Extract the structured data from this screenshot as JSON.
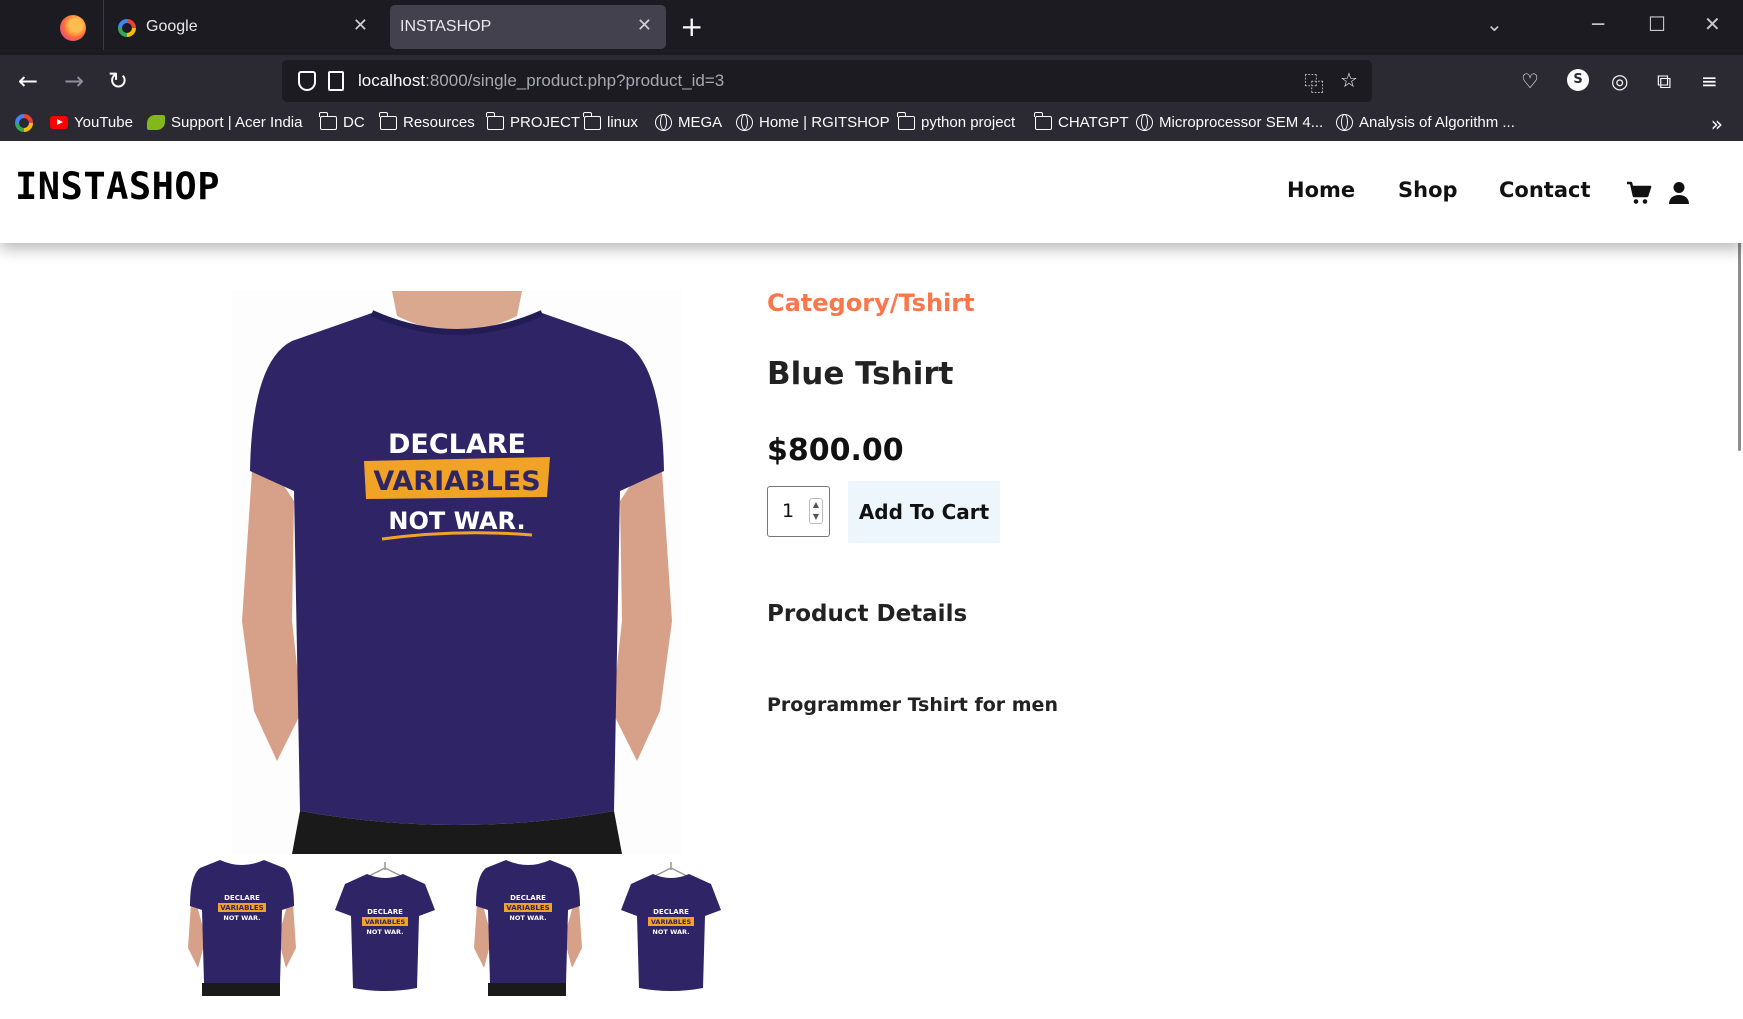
{
  "browser": {
    "tabs": [
      {
        "title": "Google",
        "active": false
      },
      {
        "title": "INSTASHOP",
        "active": true
      }
    ],
    "url": {
      "host": "localhost",
      "rest": ":8000/single_product.php?product_id=3"
    },
    "bookmarks": [
      {
        "label": "",
        "icon": "google-icon"
      },
      {
        "label": "YouTube",
        "icon": "youtube-icon"
      },
      {
        "label": "Support | Acer India",
        "icon": "acer-icon"
      },
      {
        "label": "DC",
        "icon": "folder-icon"
      },
      {
        "label": "Resources",
        "icon": "folder-icon"
      },
      {
        "label": "PROJECT",
        "icon": "folder-icon"
      },
      {
        "label": "linux",
        "icon": "folder-icon"
      },
      {
        "label": "MEGA",
        "icon": "globe-icon"
      },
      {
        "label": "Home | RGITSHOP",
        "icon": "globe-icon"
      },
      {
        "label": "python project",
        "icon": "folder-icon"
      },
      {
        "label": "CHATGPT",
        "icon": "folder-icon"
      },
      {
        "label": "Microprocessor SEM 4...",
        "icon": "globe-icon"
      },
      {
        "label": "Analysis of Algorithm ...",
        "icon": "globe-icon"
      }
    ]
  },
  "site": {
    "brand": "INSTASHOP",
    "nav": {
      "home": "Home",
      "shop": "Shop",
      "contact": "Contact"
    }
  },
  "product": {
    "category": "Category/Tshirt",
    "title": "Blue Tshirt",
    "price": "$800.00",
    "quantity": "1",
    "add_to_cart": "Add To Cart",
    "details_heading": "Product Details",
    "description": "Programmer Tshirt for men",
    "print": {
      "line1": "DECLARE",
      "line2": "VARIABLES",
      "line3": "NOT WAR."
    },
    "colors": {
      "shirt": "#2e2466",
      "accent": "#f0a327",
      "category": "#fb774b"
    }
  }
}
